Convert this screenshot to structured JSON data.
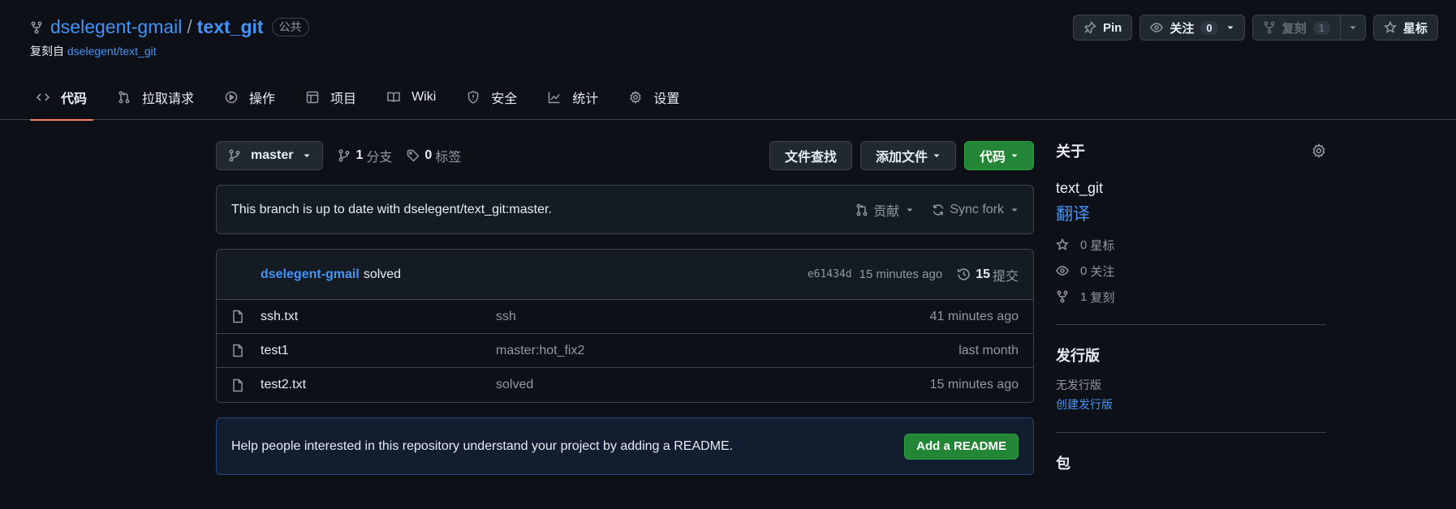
{
  "repo": {
    "owner": "dselegent-gmail",
    "separator": "/",
    "name": "text_git",
    "visibility": "公共",
    "forked_prefix": "复刻自",
    "forked_from": "dselegent/text_git"
  },
  "header_actions": {
    "pin": "Pin",
    "watch": "关注",
    "watch_count": "0",
    "fork": "复刻",
    "fork_count": "1",
    "star": "星标"
  },
  "nav": [
    {
      "label": "代码",
      "icon": "code-icon",
      "active": true
    },
    {
      "label": "拉取请求",
      "icon": "pull-request-icon"
    },
    {
      "label": "操作",
      "icon": "play-icon"
    },
    {
      "label": "项目",
      "icon": "table-icon"
    },
    {
      "label": "Wiki",
      "icon": "book-icon"
    },
    {
      "label": "安全",
      "icon": "shield-icon"
    },
    {
      "label": "统计",
      "icon": "graph-icon"
    },
    {
      "label": "设置",
      "icon": "gear-icon"
    }
  ],
  "toolbar": {
    "branch": "master",
    "branch_count": "1",
    "branch_label": "分支",
    "tag_count": "0",
    "tag_label": "标签",
    "find_file": "文件查找",
    "add_file": "添加文件",
    "code": "代码"
  },
  "sync": {
    "message": "This branch is up to date with dselegent/text_git:master.",
    "contribute": "贡献",
    "sync_fork": "Sync fork"
  },
  "latest_commit": {
    "author": "dselegent-gmail",
    "message": "solved",
    "sha": "e61434d",
    "ago": "15 minutes ago",
    "commit_count": "15",
    "commit_label": "提交"
  },
  "files": [
    {
      "name": "ssh.txt",
      "message": "ssh",
      "age": "41 minutes ago"
    },
    {
      "name": "test1",
      "message": "master:hot_fix2",
      "age": "last month"
    },
    {
      "name": "test2.txt",
      "message": "solved",
      "age": "15 minutes ago"
    }
  ],
  "readme": {
    "message": "Help people interested in this repository understand your project by adding a README.",
    "button": "Add a README"
  },
  "sidebar": {
    "about_title": "关于",
    "description": "text_git",
    "translate": "翻译",
    "stars": {
      "count": "0",
      "label": "星标"
    },
    "watchers": {
      "count": "0",
      "label": "关注"
    },
    "forks": {
      "count": "1",
      "label": "复刻"
    },
    "releases_title": "发行版",
    "no_releases": "无发行版",
    "create_release": "创建发行版",
    "packages_title": "包"
  },
  "colors": {
    "background": "#0d1117",
    "accent_link": "#4493f8",
    "primary_button": "#238636",
    "active_tab_underline": "#f78166"
  }
}
